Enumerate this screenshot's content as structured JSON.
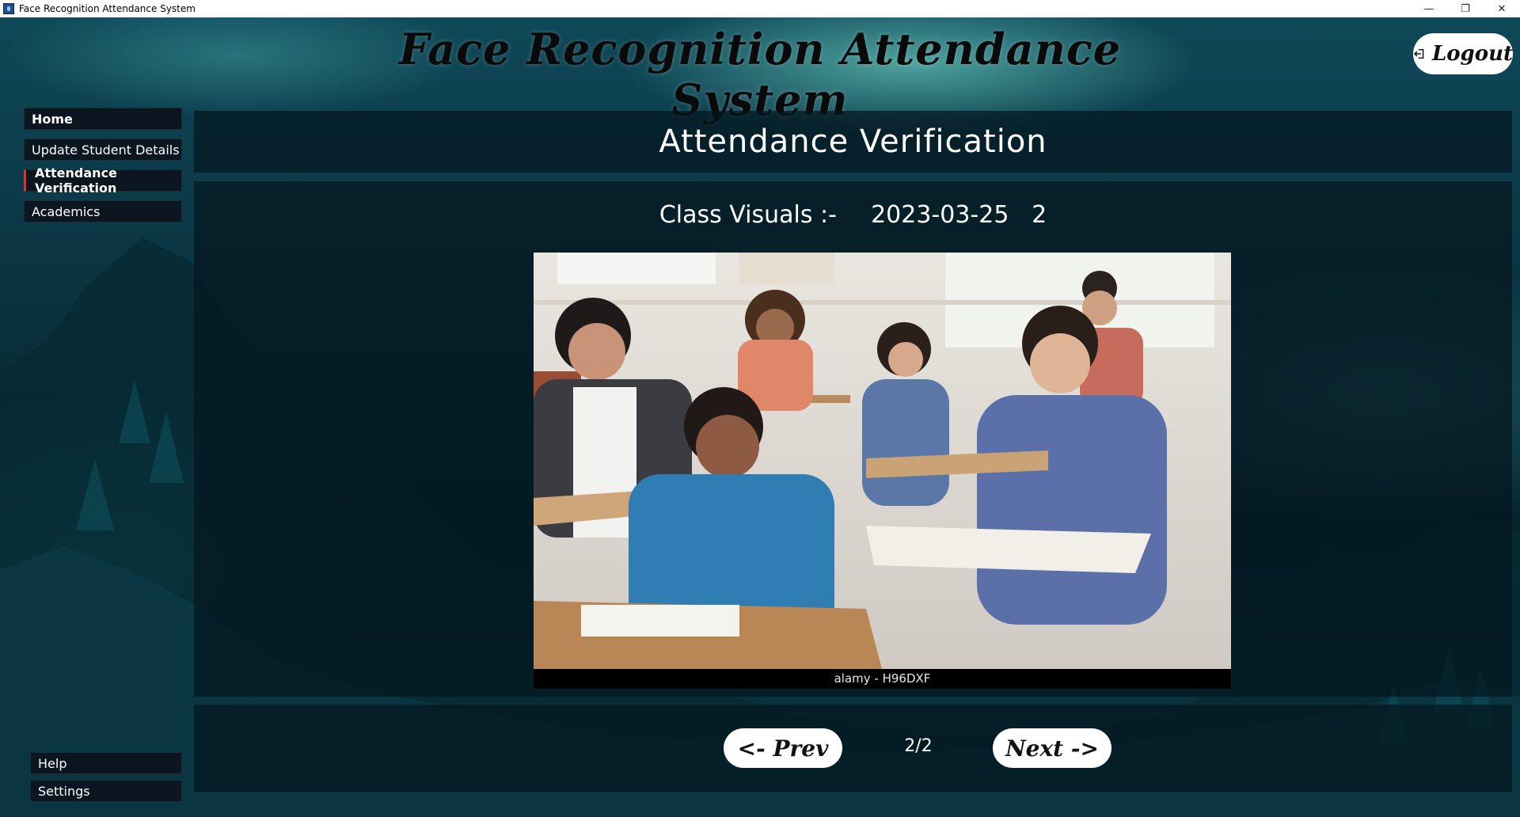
{
  "window": {
    "title": "Face Recognition Attendance System",
    "controls": {
      "minimize": "—",
      "restore": "❐",
      "close": "✕"
    }
  },
  "header": {
    "app_title": "Face Recognition Attendance System",
    "logout_label": "Logout",
    "logout_icon": "logout-icon"
  },
  "sidebar": {
    "items": [
      {
        "label": "Home",
        "active": false
      },
      {
        "label": "Update Student Details",
        "active": false
      },
      {
        "label": "Attendance Verification",
        "active": true
      },
      {
        "label": "Academics",
        "active": false
      }
    ],
    "bottom_items": [
      {
        "label": "Help"
      },
      {
        "label": "Settings"
      }
    ]
  },
  "main": {
    "page_title": "Attendance Verification",
    "class_visuals_label": "Class Visuals :-",
    "class_date": "2023-03-25",
    "class_index": "2",
    "photo_caption": "alamy - H96DXF",
    "pager": {
      "prev_label": "<- Prev",
      "next_label": "Next ->",
      "page_indicator": "2/2"
    }
  },
  "colors": {
    "active_marker": "#e23030",
    "panel_bg": "#04161e",
    "button_bg": "#ffffff"
  }
}
